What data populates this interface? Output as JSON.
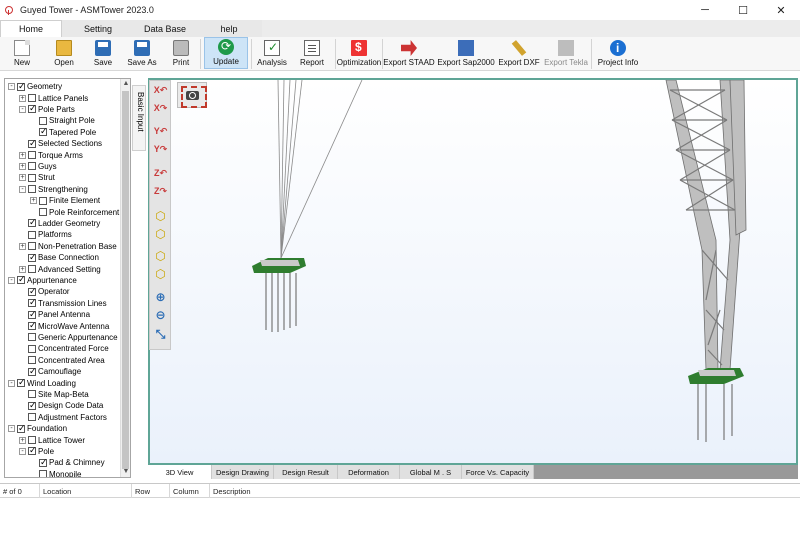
{
  "window": {
    "title": "Guyed Tower - ASMTower 2023.0",
    "minimize": "─",
    "maximize": "☐",
    "close": "✕"
  },
  "tabs": [
    {
      "label": "Home",
      "active": true
    },
    {
      "label": "Setting"
    },
    {
      "label": "Data Base"
    },
    {
      "label": "help"
    }
  ],
  "ribbon": {
    "new": "New",
    "open": "Open",
    "save": "Save",
    "save_as": "Save As",
    "print": "Print",
    "update": "Update",
    "analysis": "Analysis",
    "report": "Report",
    "optimization": "Optimization",
    "export_staad": "Export STAAD",
    "export_sap": "Export Sap2000",
    "export_dxf": "Export DXF",
    "export_tekla": "Export Tekla",
    "project_info": "Project Info"
  },
  "tree": [
    {
      "label": "Geometry",
      "level": 0,
      "checked": true,
      "expander": "-"
    },
    {
      "label": "Lattice Panels",
      "level": 1,
      "checked": false,
      "expander": "+"
    },
    {
      "label": "Pole Parts",
      "level": 1,
      "checked": true,
      "expander": "-"
    },
    {
      "label": "Straight Pole",
      "level": 2,
      "checked": false,
      "expander": ""
    },
    {
      "label": "Tapered Pole",
      "level": 2,
      "checked": true,
      "expander": ""
    },
    {
      "label": "Selected Sections",
      "level": 1,
      "checked": true,
      "expander": ""
    },
    {
      "label": "Torque Arms",
      "level": 1,
      "checked": false,
      "expander": "+"
    },
    {
      "label": "Guys",
      "level": 1,
      "checked": false,
      "expander": "+"
    },
    {
      "label": "Strut",
      "level": 1,
      "checked": false,
      "expander": "+"
    },
    {
      "label": "Strengthening",
      "level": 1,
      "checked": false,
      "expander": "-"
    },
    {
      "label": "Finite Element",
      "level": 2,
      "checked": false,
      "expander": "+"
    },
    {
      "label": "Pole Reinforcement",
      "level": 2,
      "checked": false,
      "expander": ""
    },
    {
      "label": "Ladder Geometry",
      "level": 1,
      "checked": true,
      "expander": ""
    },
    {
      "label": "Platforms",
      "level": 1,
      "checked": false,
      "expander": ""
    },
    {
      "label": "Non-Penetration Base",
      "level": 1,
      "checked": false,
      "expander": "+"
    },
    {
      "label": "Base Connection",
      "level": 1,
      "checked": true,
      "expander": ""
    },
    {
      "label": "Advanced Setting",
      "level": 1,
      "checked": false,
      "expander": "+"
    },
    {
      "label": "Appurtenance",
      "level": 0,
      "checked": true,
      "expander": "-"
    },
    {
      "label": "Operator",
      "level": 1,
      "checked": true,
      "expander": ""
    },
    {
      "label": "Transmission Lines",
      "level": 1,
      "checked": true,
      "expander": ""
    },
    {
      "label": "Panel Antenna",
      "level": 1,
      "checked": true,
      "expander": ""
    },
    {
      "label": "MicroWave Antenna",
      "level": 1,
      "checked": true,
      "expander": ""
    },
    {
      "label": "Generic Appurtenance",
      "level": 1,
      "checked": false,
      "expander": ""
    },
    {
      "label": "Concentrated Force",
      "level": 1,
      "checked": false,
      "expander": ""
    },
    {
      "label": "Concentrated Area",
      "level": 1,
      "checked": false,
      "expander": ""
    },
    {
      "label": "Camouflage",
      "level": 1,
      "checked": true,
      "expander": ""
    },
    {
      "label": "Wind Loading",
      "level": 0,
      "checked": true,
      "expander": "-"
    },
    {
      "label": "Site Map-Beta",
      "level": 1,
      "checked": false,
      "expander": ""
    },
    {
      "label": "Design Code Data",
      "level": 1,
      "checked": true,
      "expander": ""
    },
    {
      "label": "Adjustment Factors",
      "level": 1,
      "checked": false,
      "expander": ""
    },
    {
      "label": "Foundation",
      "level": 0,
      "checked": true,
      "expander": "-"
    },
    {
      "label": "Lattice Tower",
      "level": 1,
      "checked": false,
      "expander": "+"
    },
    {
      "label": "Pole",
      "level": 1,
      "checked": true,
      "expander": "-"
    },
    {
      "label": "Pad & Chimney",
      "level": 2,
      "checked": true,
      "expander": ""
    },
    {
      "label": "Monopile",
      "level": 2,
      "checked": false,
      "expander": ""
    }
  ],
  "side_tab": {
    "label": "Basic Input"
  },
  "view_tools": [
    {
      "name": "rotate-x-pos-icon",
      "glyph": "X↶"
    },
    {
      "name": "rotate-x-neg-icon",
      "glyph": "X↷"
    },
    {
      "name": "rotate-y-pos-icon",
      "glyph": "Y↶"
    },
    {
      "name": "rotate-y-neg-icon",
      "glyph": "Y↷"
    },
    {
      "name": "rotate-z-pos-icon",
      "glyph": "Z↶"
    },
    {
      "name": "rotate-z-neg-icon",
      "glyph": "Z↷"
    },
    {
      "name": "view-cube-front-icon",
      "glyph": "⬡"
    },
    {
      "name": "view-cube-side-icon",
      "glyph": "⬡"
    },
    {
      "name": "view-cube-top-icon",
      "glyph": "⬡"
    },
    {
      "name": "view-cube-iso-icon",
      "glyph": "⬡"
    },
    {
      "name": "zoom-in-icon",
      "glyph": "⊕"
    },
    {
      "name": "zoom-out-icon",
      "glyph": "⊖"
    },
    {
      "name": "zoom-extents-icon",
      "glyph": "⤡"
    }
  ],
  "bottom_tabs": [
    {
      "label": "3D View",
      "active": true
    },
    {
      "label": "Design Drawing"
    },
    {
      "label": "Design Result"
    },
    {
      "label": "Deformation"
    },
    {
      "label": "Global M . S"
    },
    {
      "label": "Force Vs. Capacity"
    }
  ],
  "grid": {
    "columns": [
      "# of 0",
      "Location",
      "Row",
      "Column",
      "Description"
    ]
  },
  "colors": {
    "accent": "#cde4f7",
    "viewport_border": "#5fa596",
    "base_plate": "#2f7d2f"
  }
}
